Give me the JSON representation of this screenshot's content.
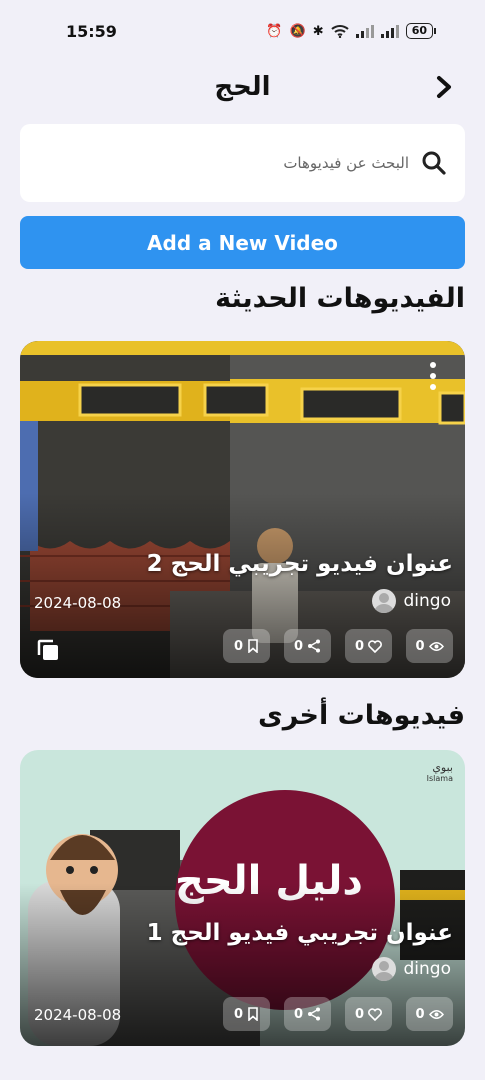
{
  "status_bar": {
    "time": "15:59",
    "battery": "60"
  },
  "header": {
    "title": "الحج"
  },
  "search": {
    "placeholder": "البحث عن فيديوهات"
  },
  "add_button": {
    "label": "Add a New Video"
  },
  "sections": {
    "recent": {
      "title": "الفيديوهات الحديثة",
      "card": {
        "title": "عنوان فيديو تجريبي الحج 2",
        "author": "dingo",
        "date": "2024-08-08",
        "views": "0",
        "likes": "0",
        "shares": "0",
        "saves": "0"
      }
    },
    "others": {
      "title": "فيديوهات أخرى",
      "card": {
        "title": "عنوان تجريبي فيديو الحج 1",
        "author": "dingo",
        "date": "2024-08-08",
        "views": "0",
        "likes": "0",
        "shares": "0",
        "saves": "0",
        "thumbnail_text": "دليل الحج",
        "channel_logo": "ببوي",
        "channel_logo_sub": "Islama"
      }
    }
  },
  "colors": {
    "accent": "#2f93f0",
    "background": "#f1f0f8",
    "kaaba_gold": "#f2c31c",
    "thumbnail_circle": "#7a1234"
  }
}
